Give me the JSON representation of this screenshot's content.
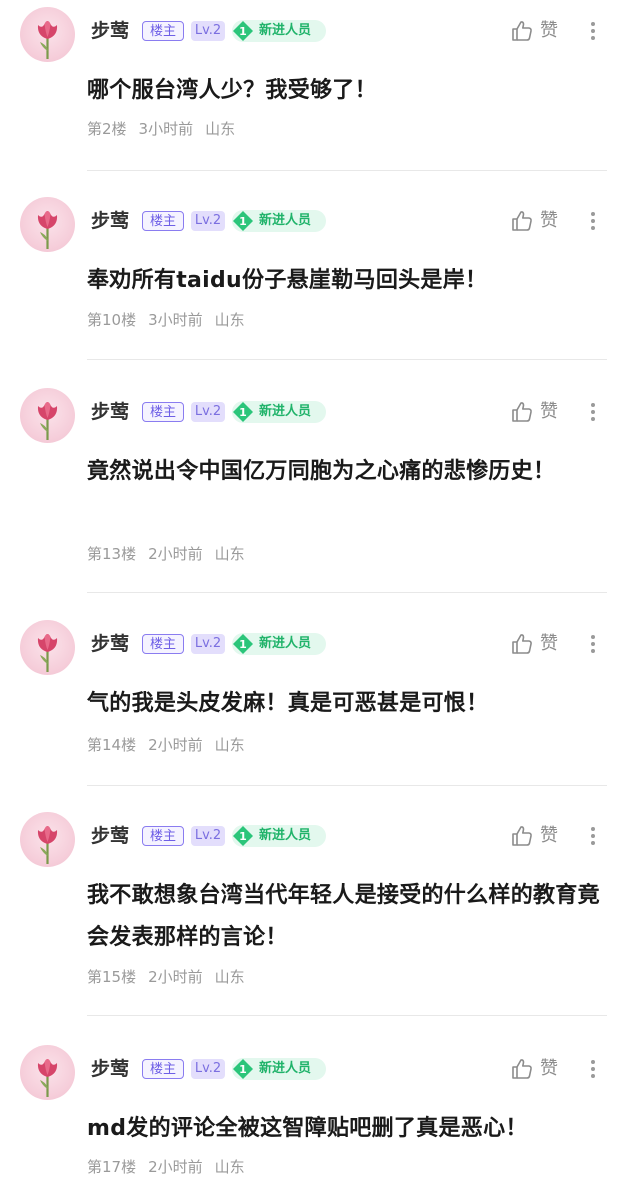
{
  "user": {
    "name": "步莺",
    "op_badge": "楼主",
    "level": "Lv.2",
    "rank_number": "1",
    "rank_title": "新进人员"
  },
  "like_label": "赞",
  "posts": [
    {
      "content": "哪个服台湾人少？我受够了！",
      "floor": "第2楼",
      "time": "3小时前",
      "location": "山东"
    },
    {
      "content": "奉劝所有taidu份子悬崖勒马回头是岸！",
      "floor": "第10楼",
      "time": "3小时前",
      "location": "山东"
    },
    {
      "content": "竟然说出令中国亿万同胞为之心痛的悲惨历史！",
      "floor": "第13楼",
      "time": "2小时前",
      "location": "山东"
    },
    {
      "content": "气的我是头皮发麻！真是可恶甚是可恨！",
      "floor": "第14楼",
      "time": "2小时前",
      "location": "山东"
    },
    {
      "content": "我不敢想象台湾当代年轻人是接受的什么样的教育竟会发表那样的言论！",
      "floor": "第15楼",
      "time": "2小时前",
      "location": "山东"
    },
    {
      "content": "md发的评论全被这智障贴吧删了真是恶心！",
      "floor": "第17楼",
      "time": "2小时前",
      "location": "山东"
    }
  ],
  "colors": {
    "op_badge": "#6e5fe6",
    "level_badge_bg": "#e3defc",
    "newbie_green": "#20b36a",
    "meta_gray": "#9a9a9a"
  }
}
